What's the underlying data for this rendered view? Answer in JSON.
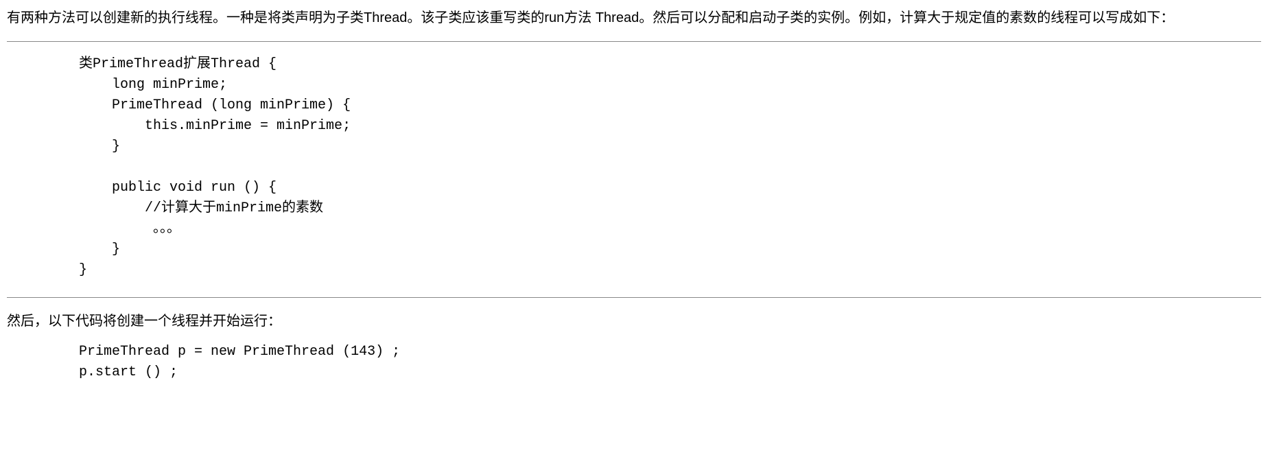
{
  "paragraph1": "有两种方法可以创建新的执行线程。一种是将类声明为子类Thread。该子类应该重写类的run方法 Thread。然后可以分配和启动子类的实例。例如，计算大于规定值的素数的线程可以写成如下：",
  "code1": "类PrimeThread扩展Thread {\n    long minPrime;\n    PrimeThread (long minPrime) {\n        this.minPrime = minPrime;\n    }\n\n    public void run () {\n        //计算大于minPrime的素数\n         。。。\n    }\n}",
  "paragraph2": "然后，以下代码将创建一个线程并开始运行：",
  "code2": "PrimeThread p = new PrimeThread (143) ;\np.start () ;"
}
